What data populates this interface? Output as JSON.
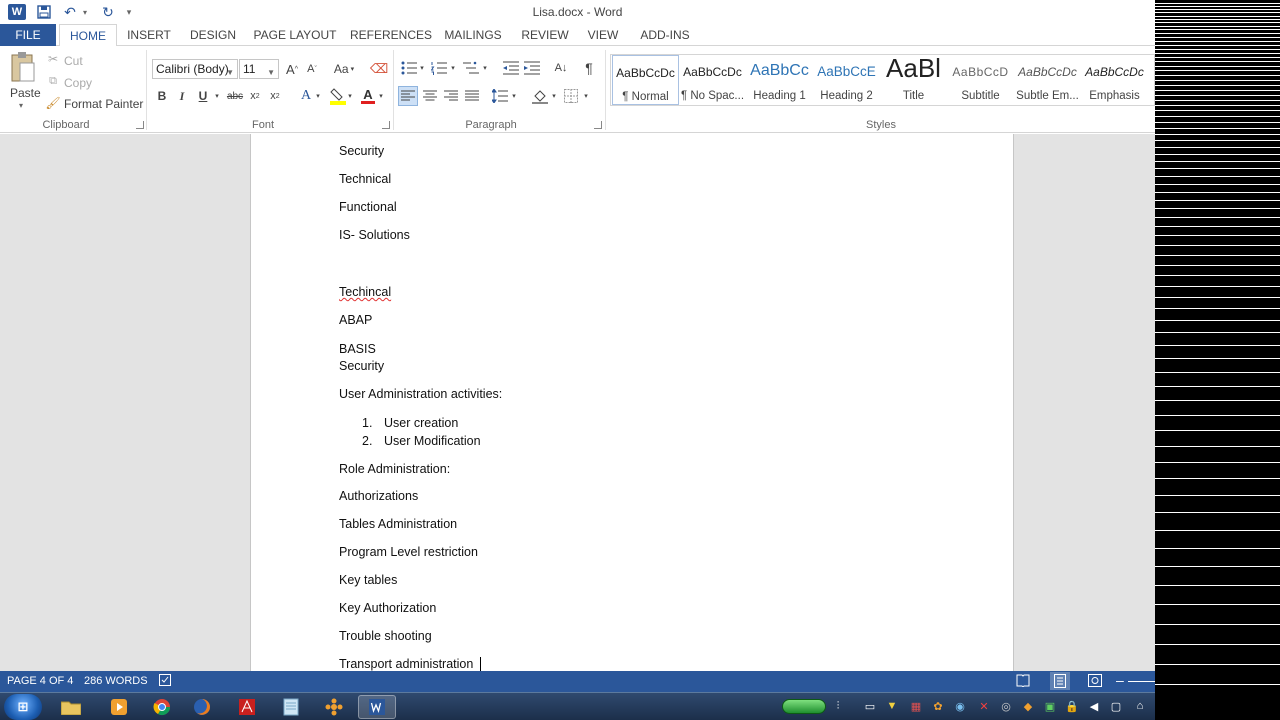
{
  "window": {
    "title": "Lisa.docx - Word"
  },
  "tabs": [
    "FILE",
    "HOME",
    "INSERT",
    "DESIGN",
    "PAGE LAYOUT",
    "REFERENCES",
    "MAILINGS",
    "REVIEW",
    "VIEW",
    "ADD-INS"
  ],
  "clipboard": {
    "paste": "Paste",
    "cut": "Cut",
    "copy": "Copy",
    "format_painter": "Format Painter",
    "label": "Clipboard"
  },
  "font": {
    "name": "Calibri (Body)",
    "size": "11",
    "label": "Font",
    "grow": "A",
    "shrink": "A",
    "case": "Aa",
    "bold": "B",
    "italic": "I",
    "underline": "U",
    "strike": "abc",
    "sub": "x",
    "sup": "x",
    "text_effects": "A",
    "font_color": "A"
  },
  "paragraph": {
    "label": "Paragraph",
    "pilcrow": "¶"
  },
  "styles": {
    "label": "Styles",
    "items": [
      {
        "preview": "AaBbCcDc",
        "name": "¶ Normal"
      },
      {
        "preview": "AaBbCcDc",
        "name": "¶ No Spac..."
      },
      {
        "preview": "AaBbCc",
        "name": "Heading 1"
      },
      {
        "preview": "AaBbCcE",
        "name": "Heading 2"
      },
      {
        "preview": "AaBl",
        "name": "Title"
      },
      {
        "preview": "AaBbCcD",
        "name": "Subtitle"
      },
      {
        "preview": "AaBbCcDc",
        "name": "Subtle Em..."
      },
      {
        "preview": "AaBbCcDc",
        "name": "Emphasis"
      }
    ]
  },
  "document": {
    "lines": [
      "Security",
      "Technical",
      "Functional",
      "IS- Solutions",
      "Techincal",
      "ABAP",
      "BASIS",
      "Security",
      "User Administration activities:",
      "Role Administration:",
      "Authorizations",
      "Tables Administration",
      "Program Level restriction",
      "Key tables",
      "Key Authorization",
      "Trouble shooting",
      "Transport administration"
    ],
    "list": [
      {
        "num": "1.",
        "text": "User creation"
      },
      {
        "num": "2.",
        "text": "User Modification"
      }
    ]
  },
  "status": {
    "page": "PAGE 4 OF 4",
    "words": "286 WORDS"
  },
  "colors": {
    "accent": "#2b579a",
    "spellcheck": "#e03030"
  }
}
